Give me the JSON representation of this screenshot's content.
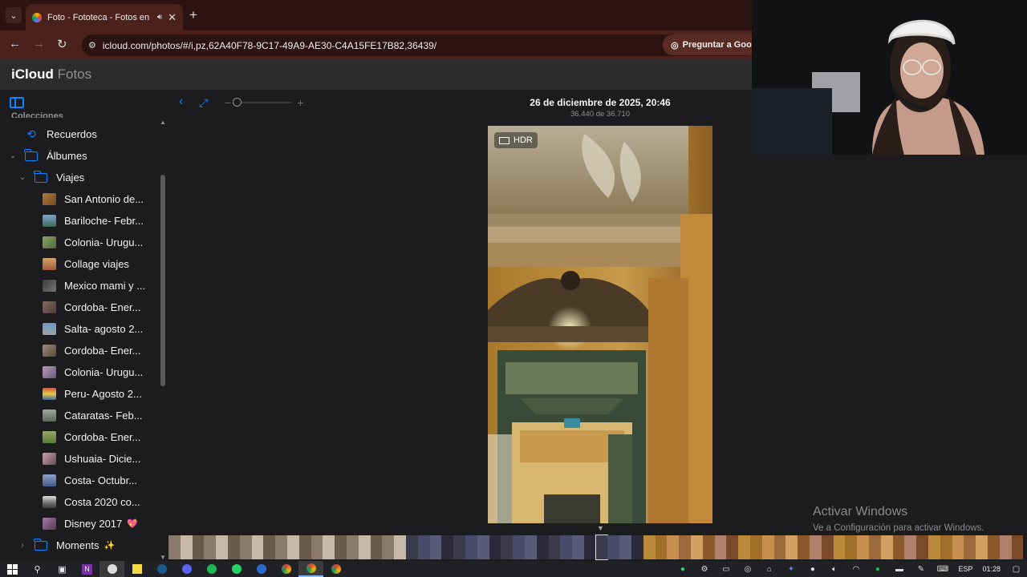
{
  "browser": {
    "tab_title": "Foto - Fototeca - Fotos en i",
    "url": "icloud.com/photos/#/i,pz,62A40F78-9C17-49A9-AE30-C4A15FE17B82,36439/",
    "ask_google_label": "Preguntar a Goog"
  },
  "app": {
    "logo_main": "iCloud",
    "logo_sub": "Fotos"
  },
  "sidebar": {
    "section_label": "Colecciones",
    "items": [
      {
        "label": "Recuerdos"
      },
      {
        "label": "Álbumes"
      },
      {
        "label": "Viajes"
      },
      {
        "label": "San Antonio de..."
      },
      {
        "label": "Bariloche- Febr..."
      },
      {
        "label": "Colonia- Urugu..."
      },
      {
        "label": "Collage viajes"
      },
      {
        "label": "Mexico mami y ..."
      },
      {
        "label": "Cordoba- Ener..."
      },
      {
        "label": "Salta- agosto 2..."
      },
      {
        "label": "Cordoba- Ener..."
      },
      {
        "label": "Colonia- Urugu..."
      },
      {
        "label": "Peru- Agosto 2..."
      },
      {
        "label": "Cataratas- Feb..."
      },
      {
        "label": "Cordoba- Ener..."
      },
      {
        "label": "Ushuaia- Dicie..."
      },
      {
        "label": "Costa- Octubr..."
      },
      {
        "label": "Costa 2020 co..."
      },
      {
        "label": "Disney 2017"
      },
      {
        "label": "Moments"
      }
    ],
    "emoji_disney": "💖",
    "emoji_moments": "✨"
  },
  "viewer": {
    "date": "26 de diciembre de 2025, 20:46",
    "count": "36.440 de 36.710",
    "hdr_label": "HDR"
  },
  "watermark": {
    "line1": "Activar Windows",
    "line2": "Ve a Configuración para activar Windows."
  },
  "taskbar": {
    "lang": "ESP",
    "time": "01:28"
  },
  "colors": {
    "accent": "#0a84ff",
    "chrome_tabbar": "#2a1310",
    "chrome_toolbar": "#4a211b"
  }
}
